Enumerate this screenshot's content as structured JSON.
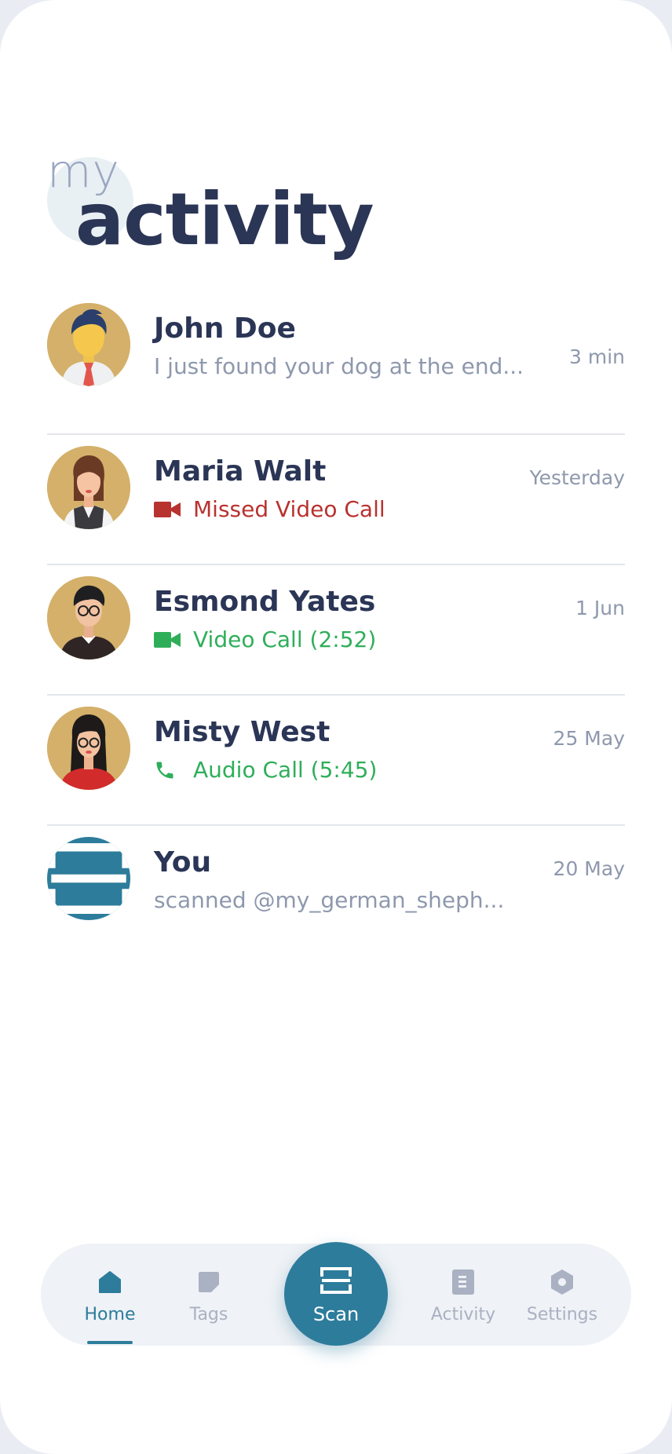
{
  "header": {
    "prefix": "my",
    "title": "activity"
  },
  "activity": [
    {
      "name": "John Doe",
      "subtitle": "I just found your dog at the end...",
      "time": "3 min",
      "kind": "message",
      "avatar": "man-tie-avatar"
    },
    {
      "name": "Maria Walt",
      "subtitle": "Missed Video Call",
      "time": "Yesterday",
      "kind": "missed-video",
      "avatar": "woman-vest-avatar"
    },
    {
      "name": "Esmond Yates",
      "subtitle": "Video Call (2:52)",
      "time": "1 Jun",
      "kind": "video",
      "avatar": "man-glasses-avatar"
    },
    {
      "name": "Misty West",
      "subtitle": "Audio Call (5:45)",
      "time": "25 May",
      "kind": "audio",
      "avatar": "woman-glasses-avatar"
    },
    {
      "name": "You",
      "subtitle": "scanned @my_german_sheph...",
      "time": "20 May",
      "kind": "scan",
      "avatar": "scan-icon"
    }
  ],
  "nav": {
    "items": [
      {
        "label": "Home",
        "icon": "home-icon",
        "active": true
      },
      {
        "label": "Tags",
        "icon": "tag-icon",
        "active": false
      },
      {
        "label": "Scan",
        "icon": "scan-icon",
        "active": false
      },
      {
        "label": "Activity",
        "icon": "document-icon",
        "active": false
      },
      {
        "label": "Settings",
        "icon": "gear-icon",
        "active": false
      }
    ]
  },
  "colors": {
    "primary": "#2d7c9b",
    "heading": "#2b3556",
    "muted": "#8e98ad",
    "missed": "#b8322f",
    "success": "#2fae5a",
    "avatar_bg": "#d4b06a"
  }
}
